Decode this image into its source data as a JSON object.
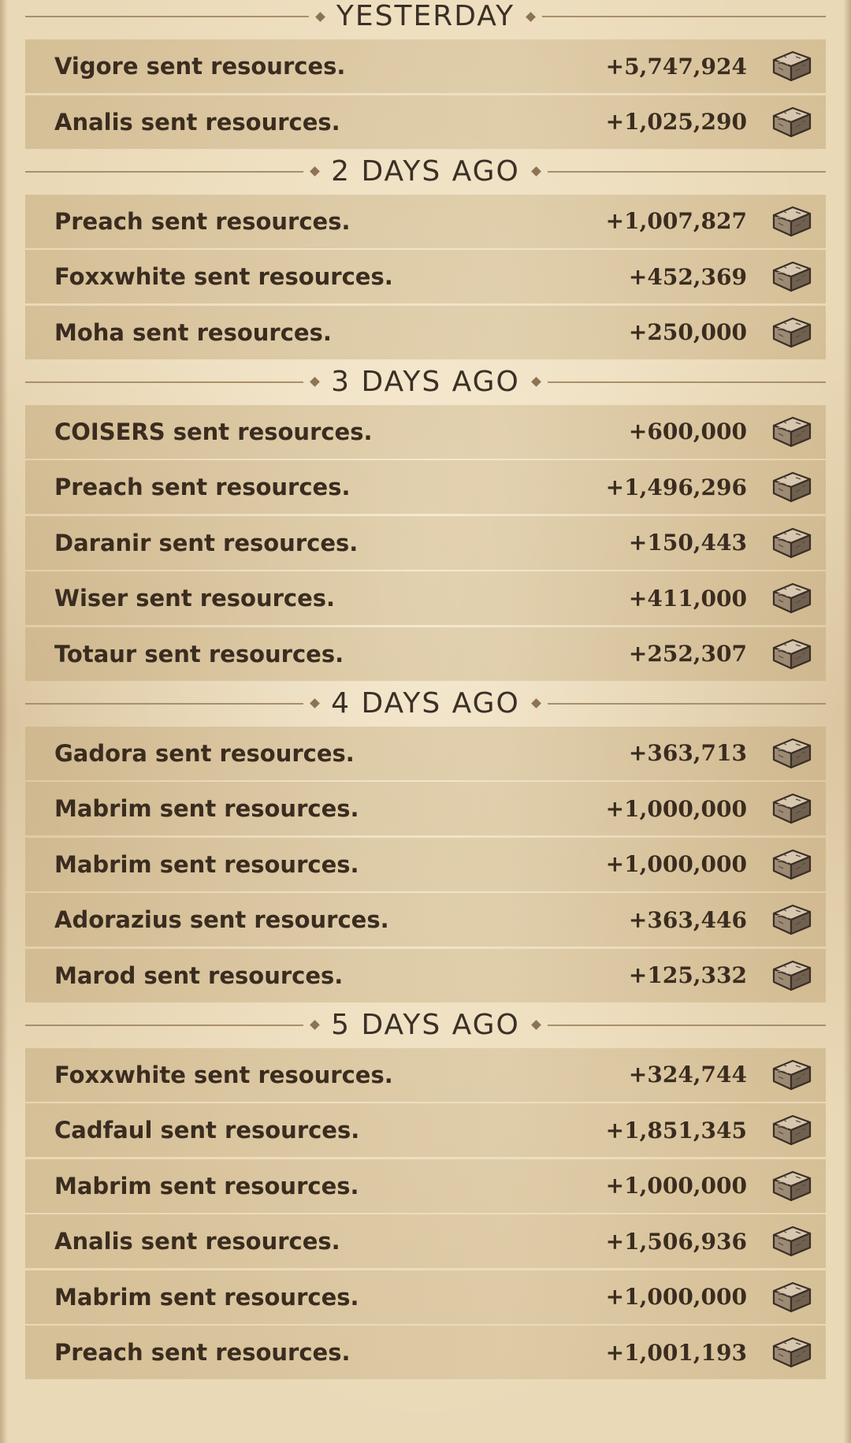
{
  "resource_icon": "stone-block-icon",
  "colors": {
    "background": "#ead9b7",
    "row": "#c4aa7d",
    "text": "#3a2c1f",
    "divider": "#a8906a"
  },
  "groups": [
    {
      "title": "YESTERDAY",
      "entries": [
        {
          "text": "Vigore sent resources.",
          "amount": "+5,747,924"
        },
        {
          "text": "Analis sent resources.",
          "amount": "+1,025,290"
        }
      ]
    },
    {
      "title": "2 DAYS AGO",
      "entries": [
        {
          "text": "Preach sent resources.",
          "amount": "+1,007,827"
        },
        {
          "text": "Foxxwhite sent resources.",
          "amount": "+452,369"
        },
        {
          "text": "Moha sent resources.",
          "amount": "+250,000"
        }
      ]
    },
    {
      "title": "3 DAYS AGO",
      "entries": [
        {
          "text": "COISERS sent resources.",
          "amount": "+600,000"
        },
        {
          "text": "Preach sent resources.",
          "amount": "+1,496,296"
        },
        {
          "text": "Daranir sent resources.",
          "amount": "+150,443"
        },
        {
          "text": "Wiser sent resources.",
          "amount": "+411,000"
        },
        {
          "text": "Totaur sent resources.",
          "amount": "+252,307"
        }
      ]
    },
    {
      "title": "4 DAYS AGO",
      "entries": [
        {
          "text": "Gadora sent resources.",
          "amount": "+363,713"
        },
        {
          "text": "Mabrim sent resources.",
          "amount": "+1,000,000"
        },
        {
          "text": "Mabrim sent resources.",
          "amount": "+1,000,000"
        },
        {
          "text": "Adorazius sent resources.",
          "amount": "+363,446"
        },
        {
          "text": "Marod sent resources.",
          "amount": "+125,332"
        }
      ]
    },
    {
      "title": "5 DAYS AGO",
      "entries": [
        {
          "text": "Foxxwhite sent resources.",
          "amount": "+324,744"
        },
        {
          "text": "Cadfaul sent resources.",
          "amount": "+1,851,345"
        },
        {
          "text": "Mabrim sent resources.",
          "amount": "+1,000,000"
        },
        {
          "text": "Analis sent resources.",
          "amount": "+1,506,936"
        },
        {
          "text": "Mabrim sent resources.",
          "amount": "+1,000,000"
        },
        {
          "text": "Preach sent resources.",
          "amount": "+1,001,193"
        }
      ]
    }
  ]
}
